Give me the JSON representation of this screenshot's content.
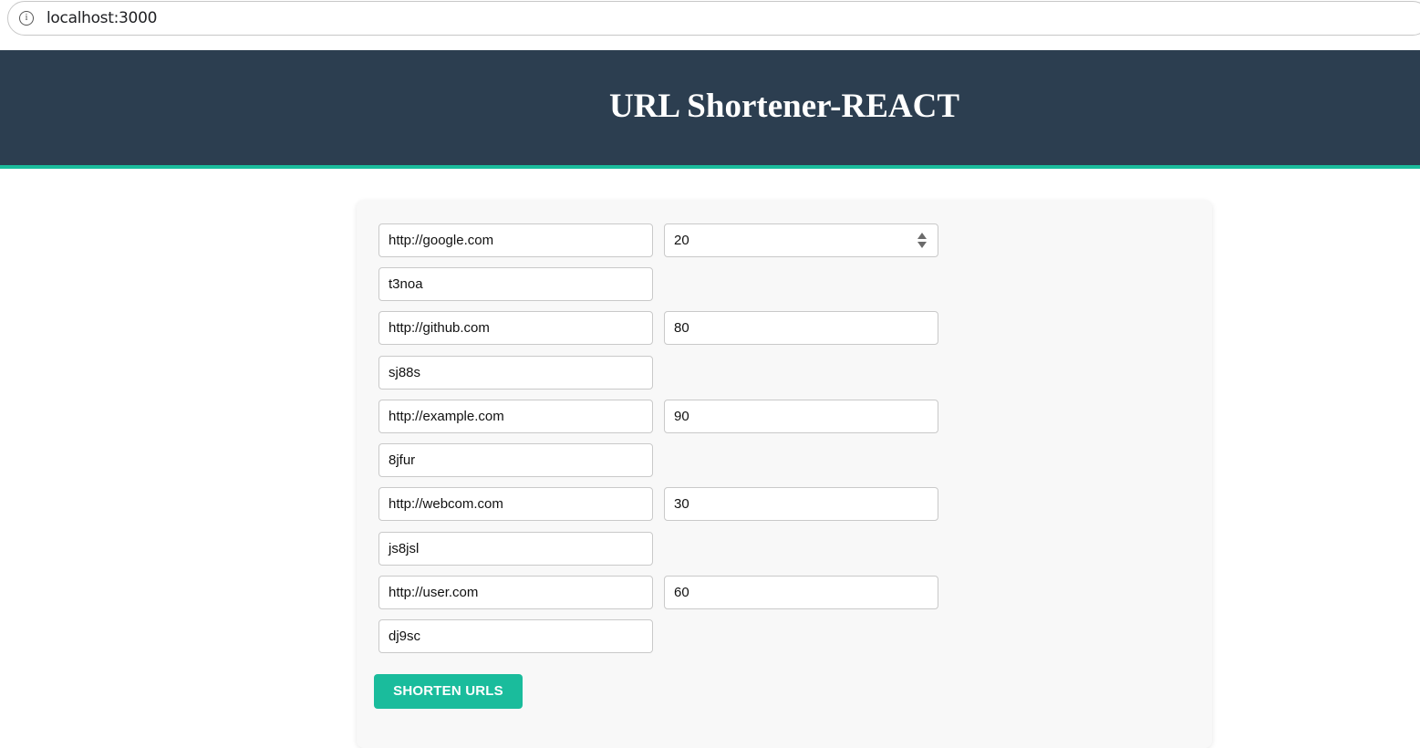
{
  "browser": {
    "url": "localhost:3000",
    "info_icon": "info-icon"
  },
  "header": {
    "title": "URL Shortener-REACT",
    "background": "#2c3e50",
    "accent": "#1abc9c"
  },
  "form": {
    "rows": [
      {
        "url": "http://google.com",
        "validity": "20",
        "shortcode": "t3noa"
      },
      {
        "url": "http://github.com",
        "validity": "80",
        "shortcode": "sj88s"
      },
      {
        "url": "http://example.com",
        "validity": "90",
        "shortcode": "8jfur"
      },
      {
        "url": "http://webcom.com",
        "validity": "30",
        "shortcode": "js8jsl"
      },
      {
        "url": "http://user.com",
        "validity": "60",
        "shortcode": "dj9sc"
      }
    ],
    "submit_label": "SHORTEN URLS"
  }
}
